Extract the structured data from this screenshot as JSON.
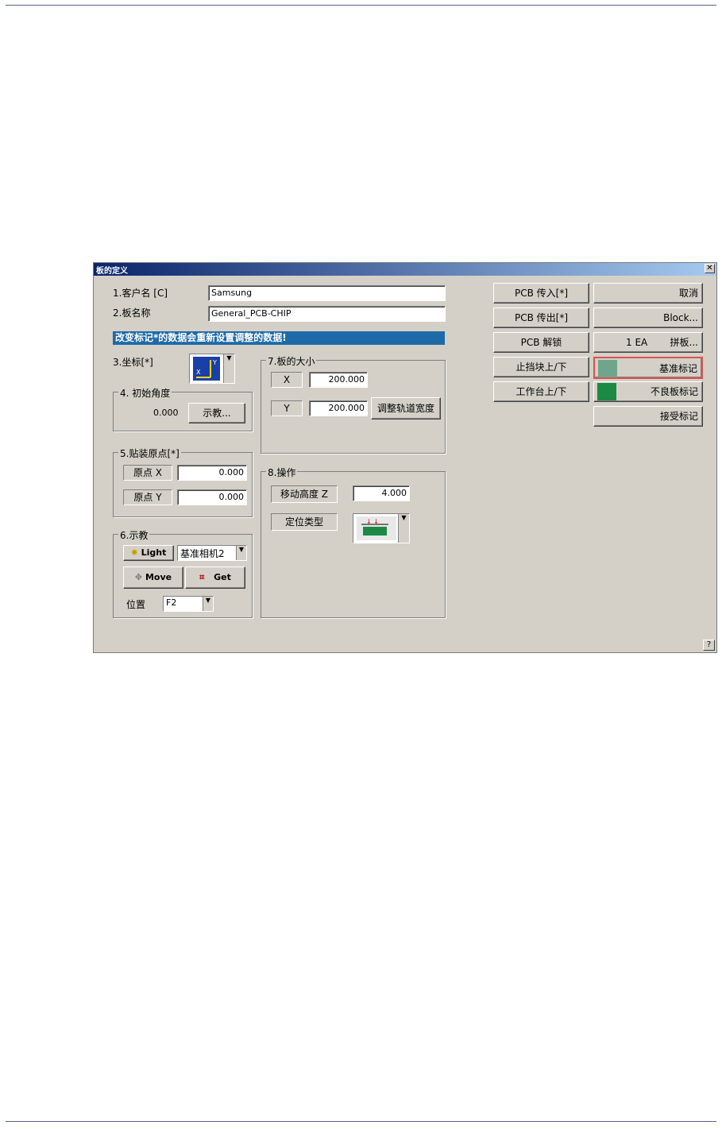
{
  "dialog": {
    "title": "板的定义",
    "close_label": "✕",
    "help_label": "?"
  },
  "fields": {
    "customer_label": "1.客户名 [C]",
    "customer_value": "Samsung",
    "board_label": "2.板名称",
    "board_value": "General_PCB-CHIP",
    "banner": "改变标记*的数据会重新设置调整的数据!"
  },
  "coord": {
    "label": "3.坐标[*]"
  },
  "angle": {
    "legend": "4. 初始角度",
    "value": "0.000",
    "teach_btn": "示教..."
  },
  "origin": {
    "legend": "5.贴装原点[*]",
    "x_label": "原点 X",
    "x_value": "0.000",
    "y_label": "原点 Y",
    "y_value": "0.000"
  },
  "teach": {
    "legend": "6.示教",
    "light_btn": "Light",
    "camera_select": "基准相机2",
    "move_btn": "Move",
    "get_btn": "Get",
    "position_label": "位置",
    "position_select": "F2"
  },
  "board_size": {
    "legend": "7.板的大小",
    "x_label": "X",
    "x_value": "200.000",
    "y_label": "Y",
    "y_value": "200.000",
    "adjust_btn": "调整轨道宽度"
  },
  "operation": {
    "legend": "8.操作",
    "move_height_label": "移动高度 Z",
    "move_height_value": "4.000",
    "locate_type_label": "定位类型"
  },
  "right_buttons": {
    "pcb_in": "PCB 传入[*]",
    "pcb_out": "PCB 传出[*]",
    "pcb_unlock": "PCB 解锁",
    "stopper": "止挡块上/下",
    "table": "工作台上/下",
    "cancel": "取消",
    "block": "Block...",
    "array_count": "1 EA",
    "array": "拼板...",
    "fiducial": "基准标记",
    "bad_mark": "不良板标记",
    "accept_mark": "接受标记"
  },
  "colors": {
    "fiducial_swatch": "#6fa58c",
    "bad_mark_swatch": "#1c8a44",
    "banner_bg": "#1e6aa8",
    "highlight_border": "#d9534f"
  }
}
